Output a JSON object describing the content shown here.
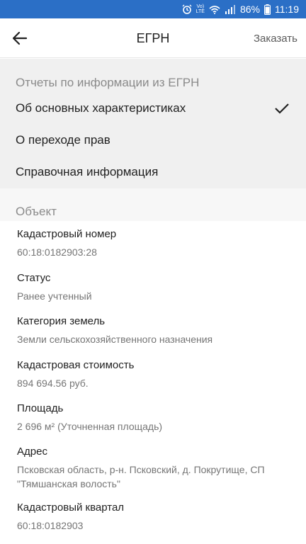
{
  "status_bar": {
    "battery": "86%",
    "time": "11:19",
    "icons": [
      "alarm-icon",
      "volte-icon",
      "wifi-icon",
      "signal-icon",
      "battery-icon"
    ]
  },
  "header": {
    "title": "ЕГРН",
    "order_label": "Заказать",
    "back_icon": "arrow-left-icon"
  },
  "reports": {
    "section_title": "Отчеты по информации из ЕГРН",
    "items": [
      {
        "label": "Об основных характеристиках",
        "selected": true
      },
      {
        "label": "О переходе прав",
        "selected": false
      },
      {
        "label": "Справочная информация",
        "selected": false
      }
    ]
  },
  "object": {
    "section_title": "Объект",
    "fields": [
      {
        "label": "Кадастровый номер",
        "value": "60:18:0182903:28"
      },
      {
        "label": "Статус",
        "value": "Ранее учтенный"
      },
      {
        "label": "Категория земель",
        "value": "Земли сельскохозяйственного назначения"
      },
      {
        "label": "Кадастровая стоимость",
        "value": "894 694.56 руб."
      },
      {
        "label": "Площадь",
        "value": "2 696 м² (Уточненная площадь)"
      },
      {
        "label": "Адрес",
        "value_line1": "Псковская область, р-н. Псковский, д. Покрутище, СП",
        "value_line2": "\"Тямшанская волость\""
      },
      {
        "label": "Кадастровый квартал",
        "value": "60:18:0182903"
      }
    ]
  },
  "colors": {
    "status_bar": "#2b6fc6",
    "section_bg": "#f0f0f0",
    "header_text": "#8a8a8a",
    "value_text": "#757575"
  }
}
